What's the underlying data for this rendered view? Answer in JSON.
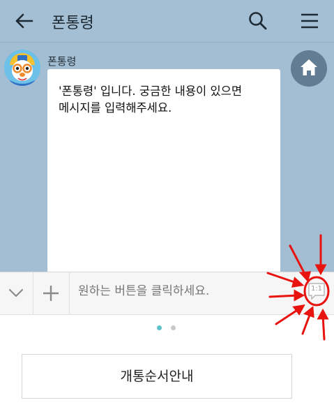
{
  "header": {
    "title": "폰통령",
    "back_icon": "arrow-left-icon",
    "search_icon": "search-icon",
    "menu_icon": "hamburger-menu-icon"
  },
  "chat": {
    "sender_name": "폰통령",
    "message_lines": [
      "'폰통령' 입니다.  궁금한 내용이 있으면",
      "메시지를 입력해주세요."
    ],
    "home_icon": "home-icon"
  },
  "input_bar": {
    "placeholder": "원하는 버튼을 클릭하세요.",
    "chat_mode_label": "1:1",
    "collapse_icon": "chevron-down-icon",
    "plus_icon": "plus-icon"
  },
  "pager": {
    "pages": 2,
    "current": 1
  },
  "quick_buttons": [
    {
      "label": "개통순서안내"
    }
  ],
  "colors": {
    "chat_background": "#a3bdd3",
    "home_button": "#617c93",
    "annotation_red": "#e8130f",
    "pager_active": "#5ec3c9"
  }
}
